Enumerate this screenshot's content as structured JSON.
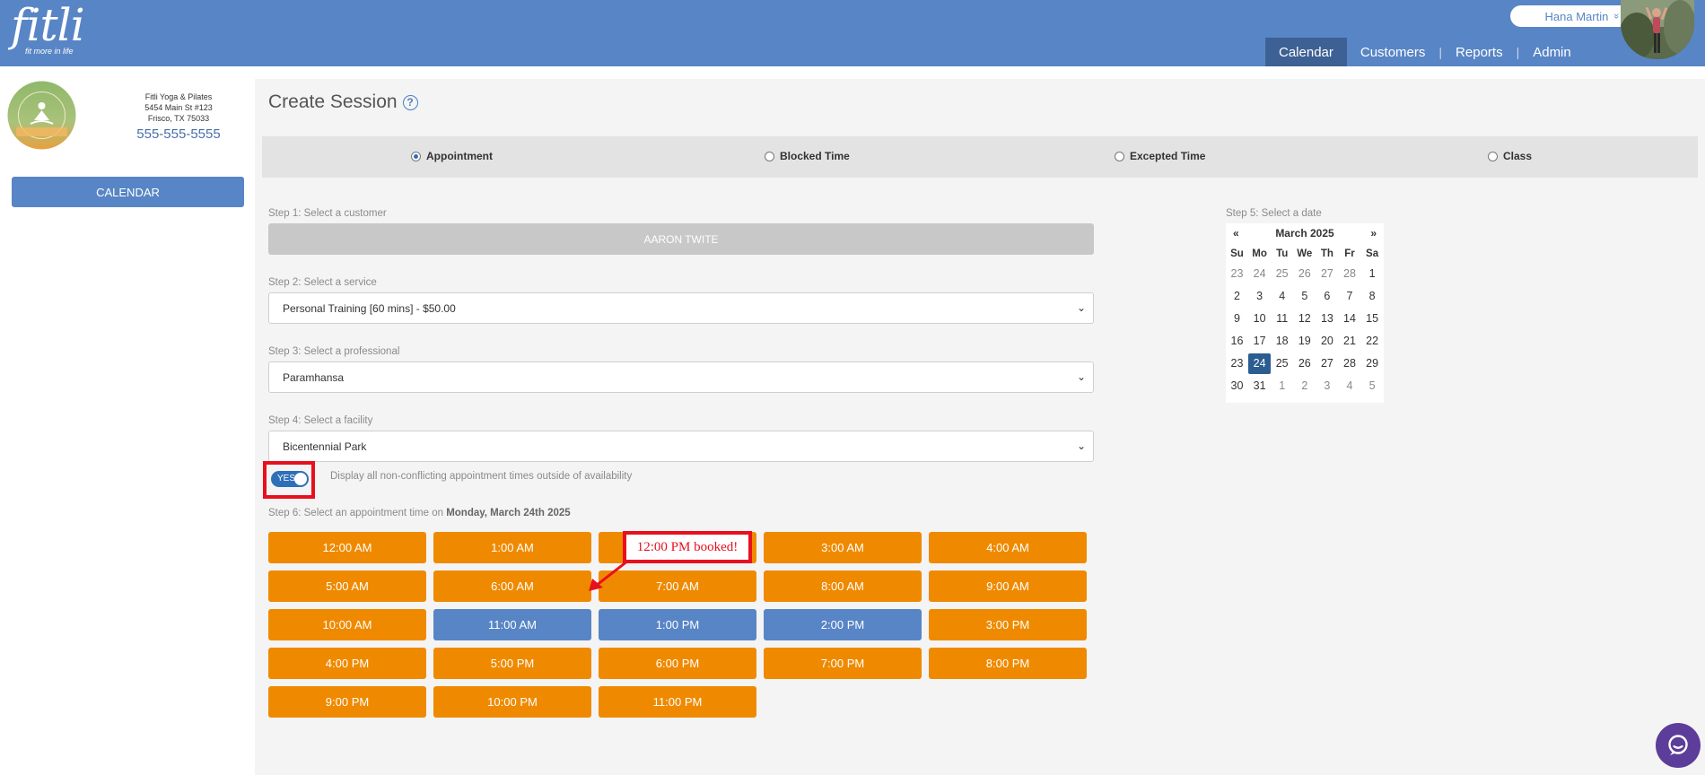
{
  "header": {
    "logo_text": "fitli",
    "logo_tagline": "fit more in life",
    "user_name": "Hana Martin",
    "user_chevron": "»",
    "nav": [
      {
        "label": "Calendar",
        "active": true
      },
      {
        "label": "Customers",
        "active": false
      },
      {
        "label": "Reports",
        "active": false
      },
      {
        "label": "Admin",
        "active": false
      }
    ],
    "nav_separator": "|"
  },
  "sidebar": {
    "business_lines": [
      "Fitli Yoga & Pilates",
      "5454 Main St #123",
      "Frisco, TX 75033"
    ],
    "phone": "555-555-5555",
    "calendar_button": "CALENDAR"
  },
  "main": {
    "title": "Create Session",
    "help_glyph": "?",
    "session_types": [
      {
        "label": "Appointment",
        "selected": true
      },
      {
        "label": "Blocked Time",
        "selected": false
      },
      {
        "label": "Excepted Time",
        "selected": false
      },
      {
        "label": "Class",
        "selected": false
      }
    ],
    "step1": {
      "label": "Step 1: Select a customer",
      "value": "AARON TWITE"
    },
    "step2": {
      "label": "Step 2: Select a service",
      "value": "Personal Training [60 mins] - $50.00"
    },
    "step3": {
      "label": "Step 3: Select a professional",
      "value": "Paramhansa"
    },
    "step4": {
      "label": "Step 4: Select a facility",
      "value": "Bicentennial Park"
    },
    "caret_glyph": "⌄",
    "toggle": {
      "label": "YES",
      "description": "Display all non-conflicting appointment times outside of availability"
    },
    "step6": {
      "label": "Step 6: Select an appointment time on",
      "date": "Monday, March 24th 2025"
    },
    "time_slots": [
      {
        "label": "12:00 AM",
        "status": "orange"
      },
      {
        "label": "1:00 AM",
        "status": "orange"
      },
      {
        "label": "",
        "status": "orange"
      },
      {
        "label": "3:00 AM",
        "status": "orange"
      },
      {
        "label": "4:00 AM",
        "status": "orange"
      },
      {
        "label": "5:00 AM",
        "status": "orange"
      },
      {
        "label": "6:00 AM",
        "status": "orange"
      },
      {
        "label": "7:00 AM",
        "status": "orange"
      },
      {
        "label": "8:00 AM",
        "status": "orange"
      },
      {
        "label": "9:00 AM",
        "status": "orange"
      },
      {
        "label": "10:00 AM",
        "status": "orange"
      },
      {
        "label": "11:00 AM",
        "status": "blue"
      },
      {
        "label": "1:00 PM",
        "status": "blue"
      },
      {
        "label": "2:00 PM",
        "status": "blue"
      },
      {
        "label": "3:00 PM",
        "status": "orange"
      },
      {
        "label": "4:00 PM",
        "status": "orange"
      },
      {
        "label": "5:00 PM",
        "status": "orange"
      },
      {
        "label": "6:00 PM",
        "status": "orange"
      },
      {
        "label": "7:00 PM",
        "status": "orange"
      },
      {
        "label": "8:00 PM",
        "status": "orange"
      },
      {
        "label": "9:00 PM",
        "status": "orange"
      },
      {
        "label": "10:00 PM",
        "status": "orange"
      },
      {
        "label": "11:00 PM",
        "status": "orange"
      }
    ],
    "annotation": "12:00 PM booked!"
  },
  "calendar": {
    "label": "Step 5: Select a date",
    "prev": "«",
    "next": "»",
    "month": "March 2025",
    "weekdays": [
      "Su",
      "Mo",
      "Tu",
      "We",
      "Th",
      "Fr",
      "Sa"
    ],
    "weeks": [
      [
        "23",
        "24",
        "25",
        "26",
        "27",
        "28",
        "1"
      ],
      [
        "2",
        "3",
        "4",
        "5",
        "6",
        "7",
        "8"
      ],
      [
        "9",
        "10",
        "11",
        "12",
        "13",
        "14",
        "15"
      ],
      [
        "16",
        "17",
        "18",
        "19",
        "20",
        "21",
        "22"
      ],
      [
        "23",
        "24",
        "25",
        "26",
        "27",
        "28",
        "29"
      ],
      [
        "30",
        "31",
        "1",
        "2",
        "3",
        "4",
        "5"
      ]
    ],
    "selected_day": "24"
  },
  "colors": {
    "header_blue": "#5885c5",
    "nav_active": "#3d6194",
    "slot_orange": "#ef8a00",
    "slot_blue": "#5885c5",
    "highlight_red": "#e8101e",
    "selected_day": "#2b5d91",
    "chat_purple": "#5c3d99"
  },
  "icons": {
    "help": "question-circle-icon",
    "chat": "chat-bubble-icon",
    "dropdown": "chevron-down-icon"
  }
}
